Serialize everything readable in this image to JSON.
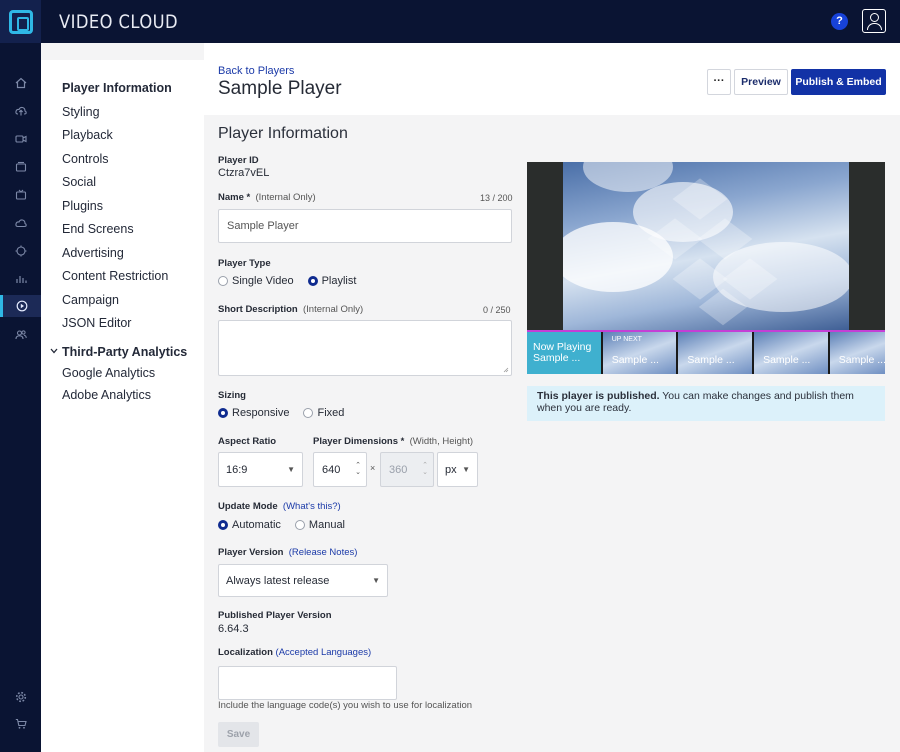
{
  "app": {
    "brand": "VIDEO CLOUD",
    "help_label": "?"
  },
  "subnav": {
    "items": [
      {
        "label": "Player Information",
        "active": true
      },
      {
        "label": "Styling"
      },
      {
        "label": "Playback"
      },
      {
        "label": "Controls"
      },
      {
        "label": "Social"
      },
      {
        "label": "Plugins"
      },
      {
        "label": "End Screens"
      },
      {
        "label": "Advertising"
      },
      {
        "label": "Content Restriction"
      },
      {
        "label": "Campaign"
      },
      {
        "label": "JSON Editor"
      }
    ],
    "analytics_header": "Third-Party Analytics",
    "analytics_items": [
      {
        "label": "Google Analytics"
      },
      {
        "label": "Adobe Analytics"
      }
    ]
  },
  "header": {
    "back_link": "Back to Players",
    "title": "Sample Player",
    "more_label": "···",
    "preview_label": "Preview",
    "publish_label": "Publish & Embed"
  },
  "form": {
    "section_title": "Player Information",
    "player_id_label": "Player ID",
    "player_id_value": "Ctzra7vEL",
    "name_label": "Name *",
    "name_hint": "(Internal Only)",
    "name_counter": "13 / 200",
    "name_value": "Sample Player",
    "player_type_label": "Player Type",
    "player_type_options": [
      "Single Video",
      "Playlist"
    ],
    "player_type_selected": "Playlist",
    "short_desc_label": "Short Description",
    "short_desc_hint": "(Internal Only)",
    "short_desc_counter": "0 / 250",
    "short_desc_value": "",
    "sizing_label": "Sizing",
    "sizing_options": [
      "Responsive",
      "Fixed"
    ],
    "sizing_selected": "Responsive",
    "aspect_ratio_label": "Aspect Ratio",
    "aspect_ratio_value": "16:9",
    "dimensions_label": "Player Dimensions *",
    "dimensions_hint": "(Width, Height)",
    "width_value": "640",
    "height_value": "360",
    "times": "×",
    "unit_value": "px",
    "update_mode_label": "Update Mode",
    "update_mode_link": "(What's this?)",
    "update_mode_options": [
      "Automatic",
      "Manual"
    ],
    "update_mode_selected": "Automatic",
    "player_version_label": "Player Version",
    "player_version_link": "(Release Notes)",
    "player_version_value": "Always latest release",
    "published_version_label": "Published Player Version",
    "published_version_value": "6.64.3",
    "localization_label": "Localization",
    "localization_link": "(Accepted Languages)",
    "localization_value": "",
    "localization_help": "Include the language code(s) you wish to use for localization",
    "save_label": "Save"
  },
  "preview": {
    "now_playing_line1": "Now Playing",
    "now_playing_line2": "Sample ...",
    "up_next": "UP NEXT",
    "thumb_titles": [
      "Sample ...",
      "Sample ...",
      "Sample ...",
      "Sample ..."
    ],
    "notice_bold": "This player is published.",
    "notice_text": " You can make changes and publish them when you are ready."
  },
  "colors": {
    "topbar": "#0a1433",
    "primary_button": "#1232a6",
    "accent": "#2fb8e6",
    "progress": "#c43fd6",
    "notice_bg": "#dcf1fa"
  },
  "icons": {
    "rail": [
      "home-icon",
      "upload-icon",
      "video-icon",
      "media-icon",
      "live-icon",
      "cloud-icon",
      "target-icon",
      "analytics-icon",
      "players-icon",
      "users-icon",
      "settings-icon",
      "cart-icon"
    ]
  }
}
